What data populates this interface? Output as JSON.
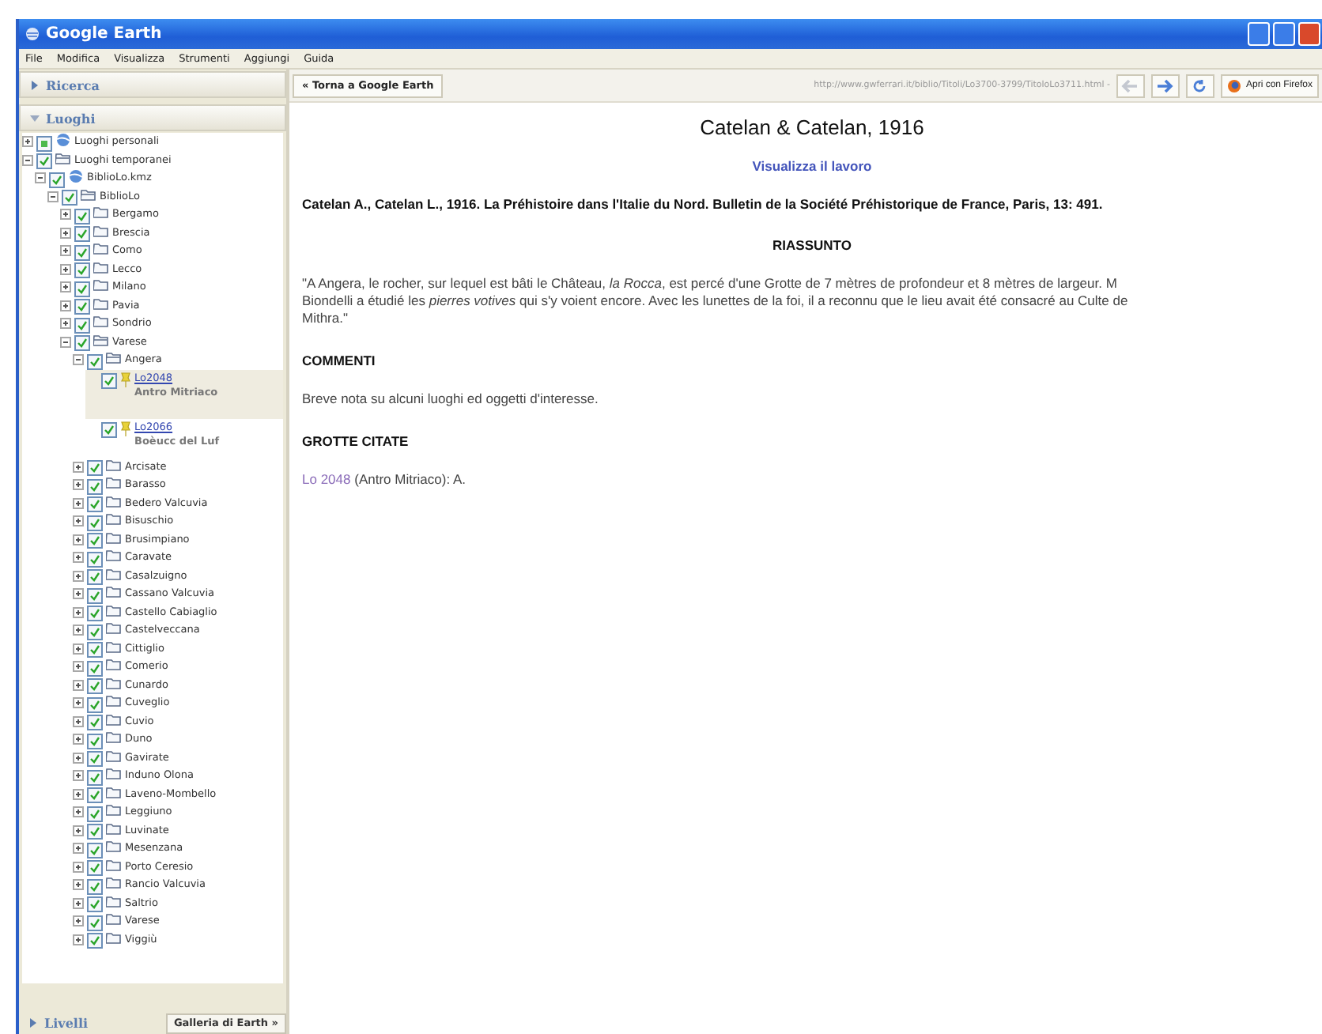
{
  "window": {
    "title": "Google Earth"
  },
  "menu": [
    "File",
    "Modifica",
    "Visualizza",
    "Strumenti",
    "Aggiungi",
    "Guida"
  ],
  "sidebar": {
    "search_panel": {
      "label": "Ricerca",
      "expanded": false
    },
    "places_panel": {
      "label": "Luoghi",
      "expanded": true
    },
    "tree": [
      {
        "label": "Luoghi personali",
        "kind": "globe",
        "expanded": false,
        "partial": true
      },
      {
        "label": "Luoghi temporanei",
        "kind": "folder",
        "expanded": true,
        "checked": true,
        "children": [
          {
            "label": "BiblioLo.kmz",
            "kind": "globe",
            "expanded": true,
            "checked": true,
            "children": [
              {
                "label": "BiblioLo",
                "kind": "folder",
                "expanded": true,
                "checked": true,
                "children": [
                  {
                    "label": "Bergamo",
                    "kind": "folder",
                    "expanded": false,
                    "checked": true
                  },
                  {
                    "label": "Brescia",
                    "kind": "folder",
                    "expanded": false,
                    "checked": true
                  },
                  {
                    "label": "Como",
                    "kind": "folder",
                    "expanded": false,
                    "checked": true
                  },
                  {
                    "label": "Lecco",
                    "kind": "folder",
                    "expanded": false,
                    "checked": true
                  },
                  {
                    "label": "Milano",
                    "kind": "folder",
                    "expanded": false,
                    "checked": true
                  },
                  {
                    "label": "Pavia",
                    "kind": "folder",
                    "expanded": false,
                    "checked": true
                  },
                  {
                    "label": "Sondrio",
                    "kind": "folder",
                    "expanded": false,
                    "checked": true
                  },
                  {
                    "label": "Varese",
                    "kind": "folder",
                    "expanded": true,
                    "checked": true,
                    "children": [
                      {
                        "label": "Angera",
                        "kind": "folder",
                        "expanded": true,
                        "checked": true,
                        "children": [
                          {
                            "label": "Lo2048",
                            "subtitle": "Antro Mitriaco",
                            "kind": "placemark",
                            "checked": true,
                            "selected": true
                          },
                          {
                            "label": "Lo2066",
                            "subtitle": "Boèucc del Luf",
                            "kind": "placemark",
                            "checked": true,
                            "selected": false
                          }
                        ]
                      },
                      {
                        "label": "Arcisate",
                        "kind": "folder",
                        "expanded": false,
                        "checked": true
                      },
                      {
                        "label": "Barasso",
                        "kind": "folder",
                        "expanded": false,
                        "checked": true
                      },
                      {
                        "label": "Bedero Valcuvia",
                        "kind": "folder",
                        "expanded": false,
                        "checked": true
                      },
                      {
                        "label": "Bisuschio",
                        "kind": "folder",
                        "expanded": false,
                        "checked": true
                      },
                      {
                        "label": "Brusimpiano",
                        "kind": "folder",
                        "expanded": false,
                        "checked": true
                      },
                      {
                        "label": "Caravate",
                        "kind": "folder",
                        "expanded": false,
                        "checked": true
                      },
                      {
                        "label": "Casalzuigno",
                        "kind": "folder",
                        "expanded": false,
                        "checked": true
                      },
                      {
                        "label": "Cassano Valcuvia",
                        "kind": "folder",
                        "expanded": false,
                        "checked": true
                      },
                      {
                        "label": "Castello Cabiaglio",
                        "kind": "folder",
                        "expanded": false,
                        "checked": true
                      },
                      {
                        "label": "Castelveccana",
                        "kind": "folder",
                        "expanded": false,
                        "checked": true
                      },
                      {
                        "label": "Cittiglio",
                        "kind": "folder",
                        "expanded": false,
                        "checked": true
                      },
                      {
                        "label": "Comerio",
                        "kind": "folder",
                        "expanded": false,
                        "checked": true
                      },
                      {
                        "label": "Cunardo",
                        "kind": "folder",
                        "expanded": false,
                        "checked": true
                      },
                      {
                        "label": "Cuveglio",
                        "kind": "folder",
                        "expanded": false,
                        "checked": true
                      },
                      {
                        "label": "Cuvio",
                        "kind": "folder",
                        "expanded": false,
                        "checked": true
                      },
                      {
                        "label": "Duno",
                        "kind": "folder",
                        "expanded": false,
                        "checked": true
                      },
                      {
                        "label": "Gavirate",
                        "kind": "folder",
                        "expanded": false,
                        "checked": true
                      },
                      {
                        "label": "Induno Olona",
                        "kind": "folder",
                        "expanded": false,
                        "checked": true
                      },
                      {
                        "label": "Laveno-Mombello",
                        "kind": "folder",
                        "expanded": false,
                        "checked": true
                      },
                      {
                        "label": "Leggiuno",
                        "kind": "folder",
                        "expanded": false,
                        "checked": true
                      },
                      {
                        "label": "Luvinate",
                        "kind": "folder",
                        "expanded": false,
                        "checked": true
                      },
                      {
                        "label": "Mesenzana",
                        "kind": "folder",
                        "expanded": false,
                        "checked": true
                      },
                      {
                        "label": "Porto Ceresio",
                        "kind": "folder",
                        "expanded": false,
                        "checked": true
                      },
                      {
                        "label": "Rancio Valcuvia",
                        "kind": "folder",
                        "expanded": false,
                        "checked": true
                      },
                      {
                        "label": "Saltrio",
                        "kind": "folder",
                        "expanded": false,
                        "checked": true
                      },
                      {
                        "label": "Varese",
                        "kind": "folder",
                        "expanded": false,
                        "checked": true
                      },
                      {
                        "label": "Viggiù",
                        "kind": "folder",
                        "expanded": false,
                        "checked": true
                      }
                    ]
                  }
                ]
              }
            ]
          }
        ]
      }
    ],
    "layers_panel": {
      "label": "Livelli",
      "expanded": false
    },
    "gallery_button": "Galleria di Earth »"
  },
  "browser": {
    "back_button": "« Torna a Google Earth",
    "url": "http://www.gwferrari.it/biblio/Titoli/Lo3700-3799/TitoloLo3711.html -",
    "back_disabled": true,
    "forward_disabled": false,
    "firefox_button": "Apri con Firefox"
  },
  "page": {
    "title": "Catelan & Catelan, 1916",
    "view_link": "Visualizza il lavoro",
    "citation": "Catelan A., Catelan L., 1916. La Préhistoire dans l'Italie du Nord. Bulletin de la Société Préhistorique de France, Paris, 13: 491.",
    "summary_heading": "RIASSUNTO",
    "summary_lines": [
      "\"A Angera, le rocher, sur lequel est bâti le Château, *la Rocca*, est percé d'une Grotte de 7 mètres de profondeur et 8 mètres de largeur. M",
      "Biondelli a étudié les *pierres votives* qui s'y voient encore. Avec les lunettes de la foi, il a reconnu que le lieu avait été consacré au Culte de",
      "Mithra.\""
    ],
    "comments_heading": "COMMENTI",
    "comments": "Breve nota su alcuni luoghi ed oggetti d'interesse.",
    "caves_heading": "GROTTE CITATE",
    "caves": [
      {
        "link": "Lo 2048",
        "text": "(Antro Mitriaco): A."
      }
    ]
  }
}
